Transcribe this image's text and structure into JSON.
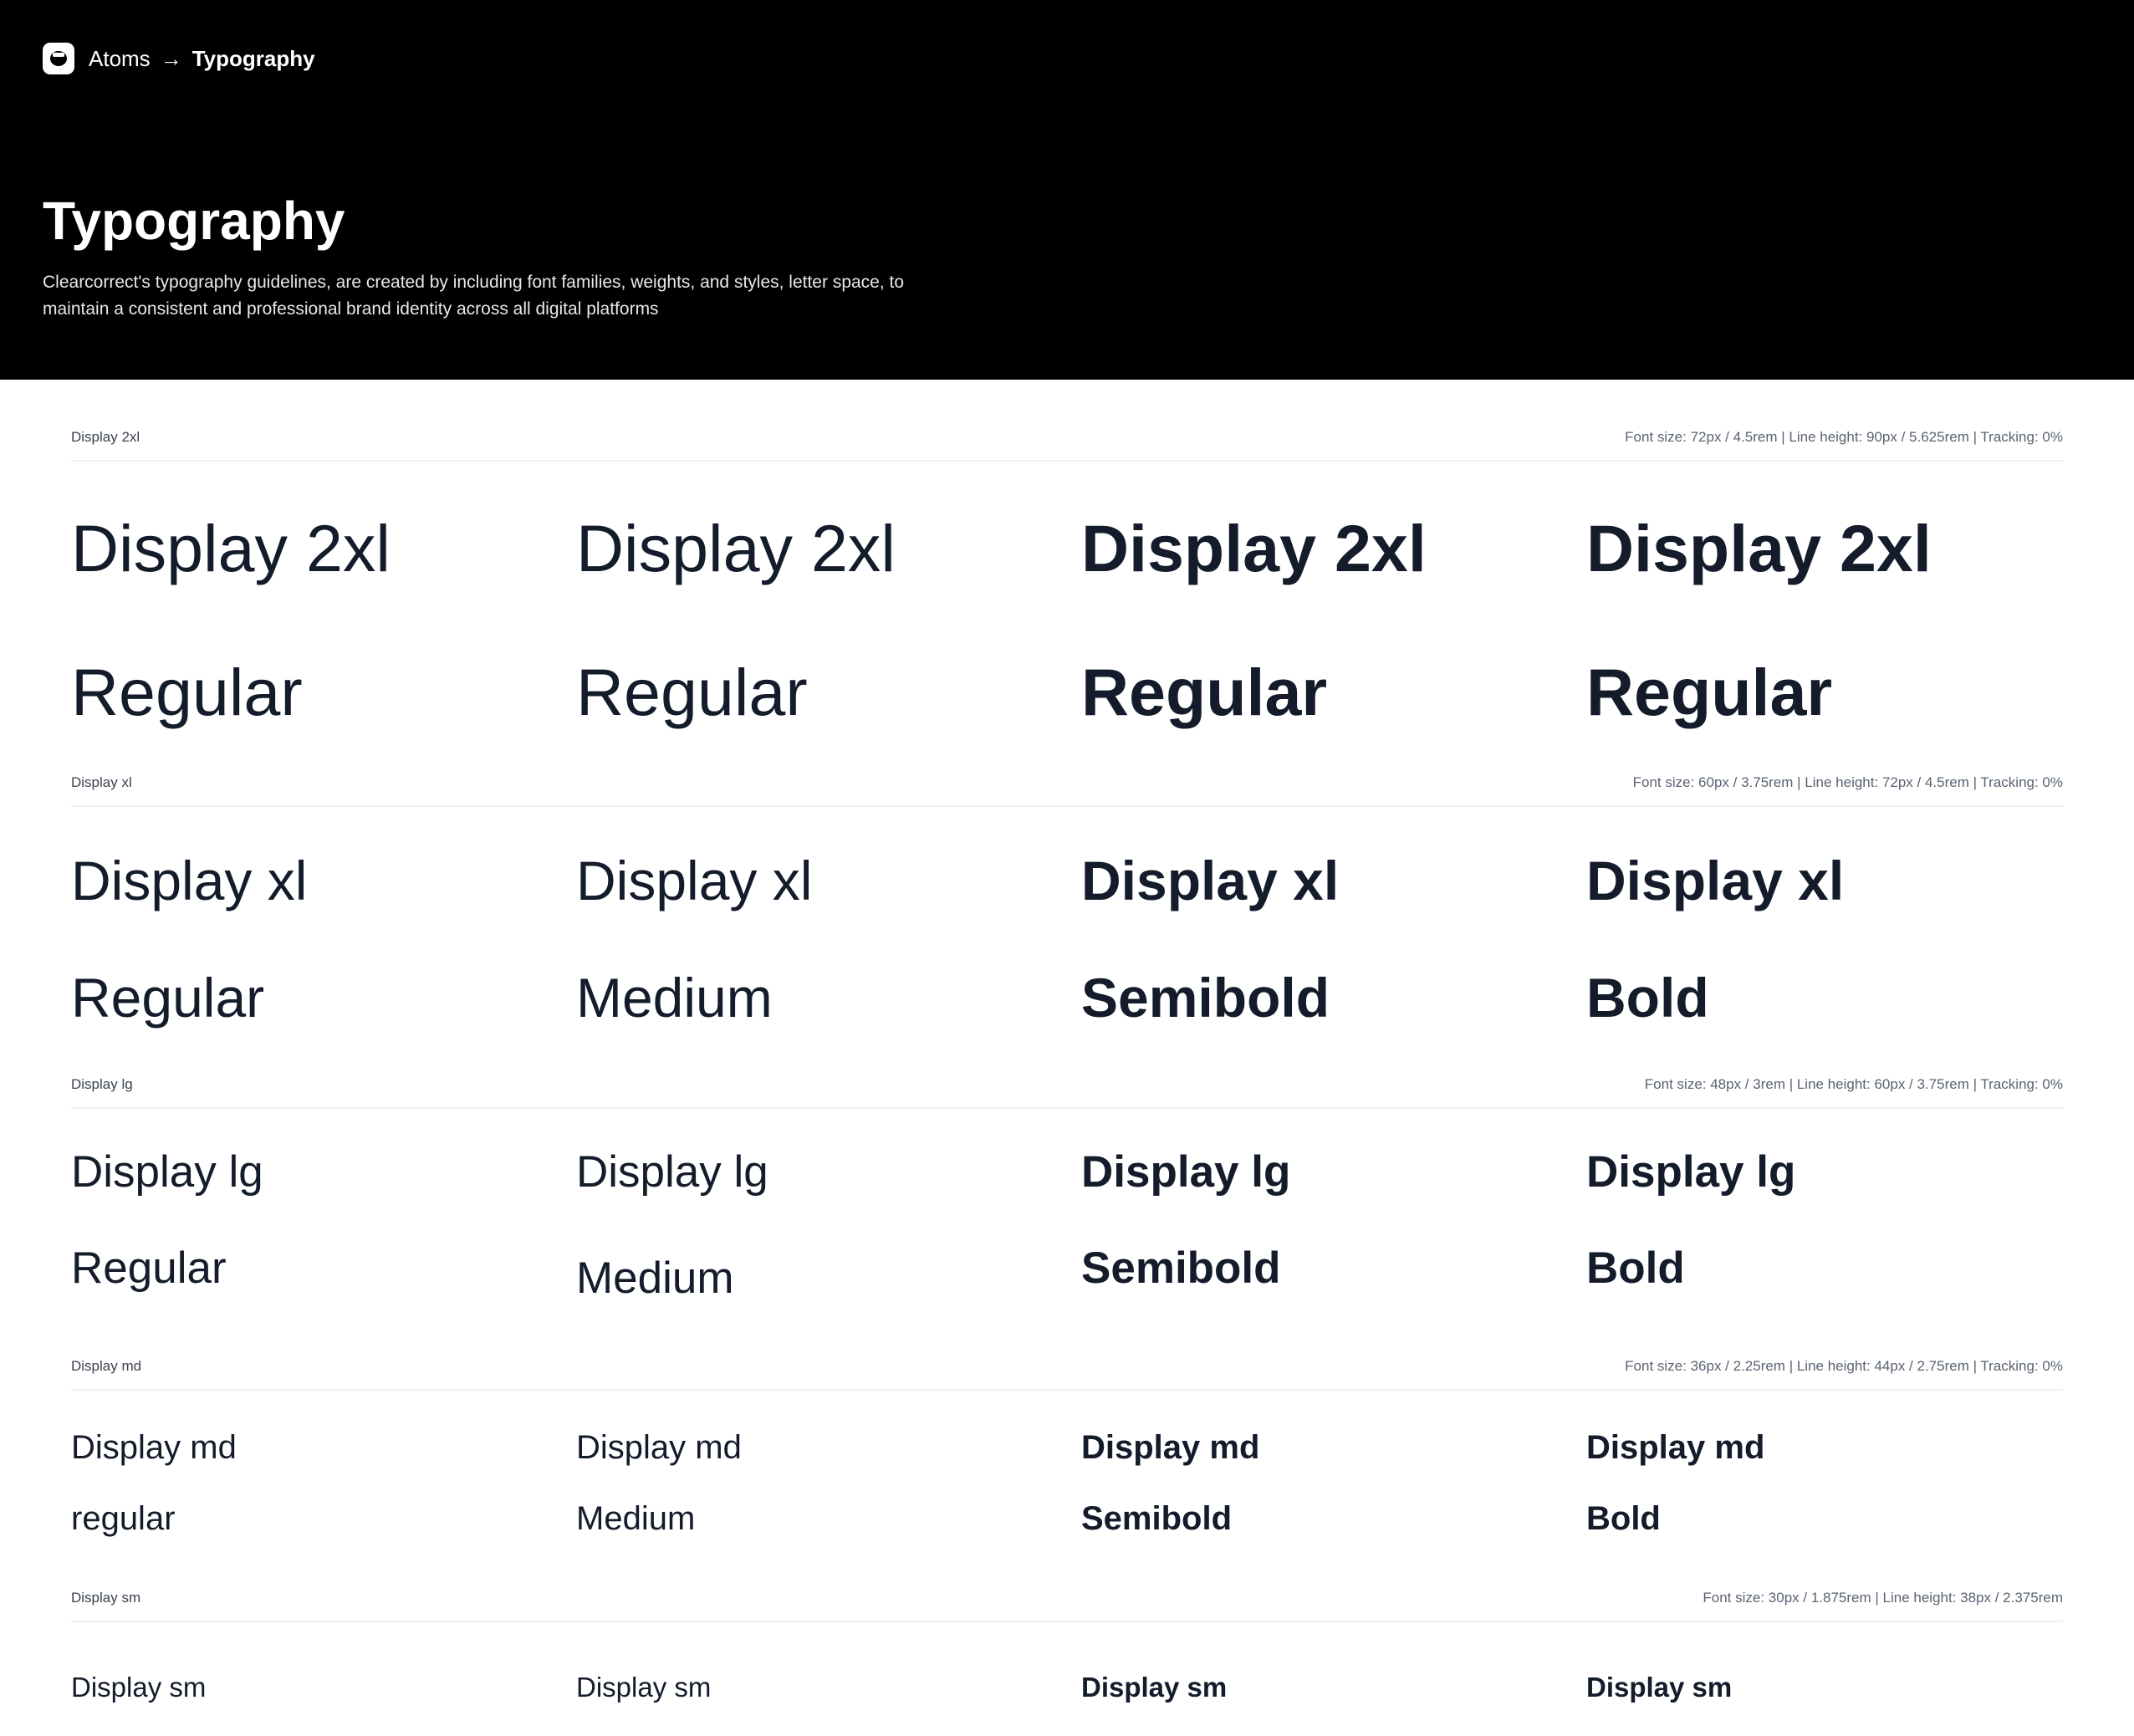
{
  "breadcrumb": {
    "root": "Atoms",
    "separator": "→",
    "current": "Typography"
  },
  "hero": {
    "title": "Typography",
    "description": "Clearcorrect's typography guidelines, are created by including font families, weights, and styles, letter space, to maintain a consistent and professional brand identity across all digital platforms"
  },
  "colors": {
    "hero_bg": "#000000",
    "text_primary": "#141c2c",
    "divider": "#eef0f3"
  },
  "sections": [
    {
      "name": "Display 2xl",
      "spec": "Font size: 72px / 4.5rem | Line height: 90px / 5.625rem | Tracking: 0%",
      "samples": [
        "Display 2xl",
        "Display 2xl",
        "Display 2xl",
        "Display 2xl"
      ],
      "weights": [
        "Regular",
        "Regular",
        "Regular",
        "Regular"
      ]
    },
    {
      "name": "Display xl",
      "spec": "Font size: 60px / 3.75rem | Line height: 72px / 4.5rem | Tracking: 0%",
      "samples": [
        "Display xl",
        "Display xl",
        "Display xl",
        "Display xl"
      ],
      "weights": [
        "Regular",
        "Medium",
        "Semibold",
        "Bold"
      ]
    },
    {
      "name": "Display lg",
      "spec": "Font size: 48px / 3rem | Line height: 60px / 3.75rem | Tracking: 0%",
      "samples": [
        "Display lg",
        "Display lg",
        "Display lg",
        "Display lg"
      ],
      "weights": [
        "Regular",
        "Medium",
        "Semibold",
        "Bold"
      ]
    },
    {
      "name": "Display md",
      "spec": "Font size: 36px / 2.25rem | Line height: 44px / 2.75rem | Tracking: 0%",
      "samples": [
        "Display md",
        "Display md",
        "Display md",
        "Display md"
      ],
      "weights": [
        "regular",
        "Medium",
        "Semibold",
        "Bold"
      ]
    },
    {
      "name": "Display sm",
      "spec": "Font size: 30px / 1.875rem | Line height: 38px / 2.375rem",
      "samples": [
        "Display sm",
        "Display sm",
        "Display sm",
        "Display sm"
      ],
      "weights": []
    }
  ]
}
